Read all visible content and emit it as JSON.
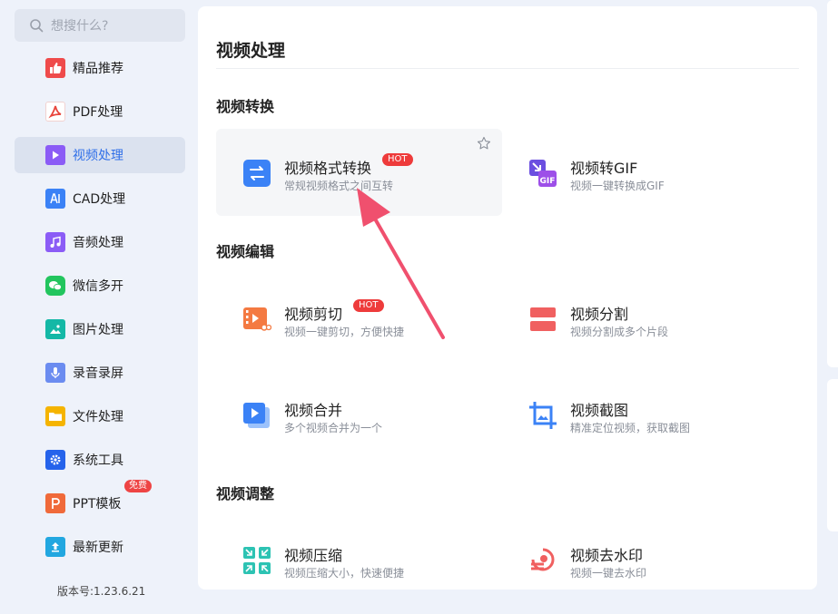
{
  "search": {
    "placeholder": "想搜什么?"
  },
  "sidebar": {
    "items": [
      {
        "label": "精品推荐",
        "icon": "thumbs-up-icon",
        "color": "#ef4b4b"
      },
      {
        "label": "PDF处理",
        "icon": "pdf-icon",
        "color": "#e8453c"
      },
      {
        "label": "视频处理",
        "icon": "play-icon",
        "color": "#8b5cf6",
        "active": true
      },
      {
        "label": "CAD处理",
        "icon": "cad-icon",
        "color": "#3b82f6"
      },
      {
        "label": "音频处理",
        "icon": "music-icon",
        "color": "#8b5cf6"
      },
      {
        "label": "微信多开",
        "icon": "wechat-icon",
        "color": "#22c55e"
      },
      {
        "label": "图片处理",
        "icon": "image-icon",
        "color": "#14b8a6"
      },
      {
        "label": "录音录屏",
        "icon": "microphone-icon",
        "color": "#6b8cf0"
      },
      {
        "label": "文件处理",
        "icon": "folder-icon",
        "color": "#f5b400"
      },
      {
        "label": "系统工具",
        "icon": "gear-icon",
        "color": "#2563eb"
      },
      {
        "label": "PPT模板",
        "icon": "ppt-icon",
        "color": "#f06a3a",
        "badge": "免费"
      },
      {
        "label": "最新更新",
        "icon": "upload-icon",
        "color": "#22a7e0"
      }
    ],
    "version": "版本号:1.23.6.21"
  },
  "main": {
    "title": "视频处理",
    "sections": [
      {
        "title": "视频转换"
      },
      {
        "title": "视频编辑"
      },
      {
        "title": "视频调整"
      }
    ],
    "tools": [
      {
        "name": "视频格式转换",
        "desc": "常规视频格式之间互转",
        "hot": "HOT",
        "icon": "convert-icon"
      },
      {
        "name": "视频转GIF",
        "desc": "视频一键转换成GIF",
        "icon": "gif-icon"
      },
      {
        "name": "视频剪切",
        "desc": "视频一键剪切，方便快捷",
        "hot": "HOT",
        "icon": "scissors-icon"
      },
      {
        "name": "视频分割",
        "desc": "视频分割成多个片段",
        "icon": "split-icon"
      },
      {
        "name": "视频合并",
        "desc": "多个视频合并为一个",
        "icon": "merge-icon"
      },
      {
        "name": "视频截图",
        "desc": "精准定位视频，获取截图",
        "icon": "crop-icon"
      },
      {
        "name": "视频压缩",
        "desc": "视频压缩大小，快速便捷",
        "icon": "compress-icon"
      },
      {
        "name": "视频去水印",
        "desc": "视频一键去水印",
        "icon": "watermark-icon"
      }
    ]
  },
  "colors": {
    "accent": "#2f6fe8",
    "hot": "#ee3b3b",
    "arrow": "#f0506e"
  }
}
